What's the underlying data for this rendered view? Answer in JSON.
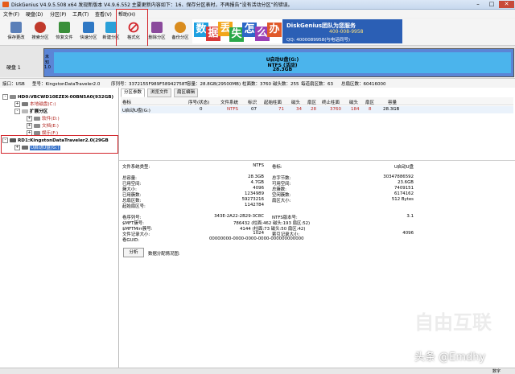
{
  "window": {
    "title": "DiskGenius V4.9.5.508 x64   发现新版本 V4.9.6.552 主要更新内容如下：16、保存分区表时，不再报告“没有活动分区”的错误。",
    "min": "–",
    "max": "□",
    "close": "✕"
  },
  "menu": [
    "文件(F)",
    "硬盘(D)",
    "分区(P)",
    "工具(T)",
    "查看(V)",
    "帮助(H)"
  ],
  "toolbar": [
    {
      "label": "保存更改",
      "icon": "save-icon",
      "color": "#5a7fb8"
    },
    {
      "label": "搜索分区",
      "icon": "search-icon",
      "color": "#c0392b"
    },
    {
      "label": "恢复文件",
      "icon": "recover-icon",
      "color": "#3a8f3a"
    },
    {
      "label": "快速分区",
      "icon": "quick-partition-icon",
      "color": "#2f78c4"
    },
    {
      "label": "新建分区",
      "icon": "new-partition-icon",
      "color": "#2aa0d8"
    },
    {
      "label": "格式化",
      "icon": "format-icon",
      "color": "#d2242a"
    },
    {
      "label": "删除分区",
      "icon": "delete-icon",
      "color": "#8b4a9c"
    },
    {
      "label": "备份分区",
      "icon": "backup-icon",
      "color": "#d98c1e"
    }
  ],
  "ad": {
    "chars": [
      "数",
      "据",
      "丢",
      "失",
      "怎",
      "么",
      "办"
    ],
    "brand": "DiskGenius团队为您服务",
    "phone": "400-008-9958",
    "qq": "QQ: 4000089958(与电话同号)"
  },
  "diskbar": {
    "disk_label": "硬盘 1",
    "side_labels": [
      "未",
      "知",
      "1.0"
    ],
    "name": "U启动U盘(G:)",
    "fs": "NTFS (活动)",
    "size": "28.3GB"
  },
  "infoline": {
    "iface": "接口：USB",
    "model": "型号：KingstonDataTraveler2.0",
    "serial": "序列号：3372155F989F58942758T",
    "capacity": "容量：28.8GB(29500MB)",
    "cylinders": "柱面数：3760",
    "heads": "磁头数：255",
    "sectors_per_track": "每道扇区数：63",
    "total_sectors": "总扇区数：60416000"
  },
  "tree": {
    "hd0": "HD0:VBCWD10EZEX-00BN5A0(932GB)",
    "hd0_children": [
      "本地磁盘(C:)",
      "扩展分区",
      "软件(D:)",
      "文档(E:)",
      "娱乐(F:)"
    ],
    "rd1": "RD1:KingstonDataTraveler2.0(29GB",
    "rd1_child": "U启动U盘(G:)"
  },
  "tabs": [
    "分区参数",
    "浏览文件",
    "扇区编辑"
  ],
  "partition_table": {
    "headers": [
      "卷标",
      "序号(状态)",
      "文件系统",
      "标识",
      "起始柱面",
      "磁头",
      "扇区",
      "终止柱面",
      "磁头",
      "扇区",
      "容量"
    ],
    "row": [
      "U启动U盘(G:)",
      "0",
      "NTFS",
      "07",
      "71",
      "34",
      "28",
      "3760",
      "184",
      "8",
      "28.3GB"
    ]
  },
  "details": {
    "fs_type_label": "文件系统类型:",
    "fs_type": "NTFS",
    "volume_label_label": "卷标:",
    "volume_label": "U启动U盘",
    "total_label": "总容量:",
    "total": "28.3GB",
    "total_bytes_label": "总字节数:",
    "total_bytes": "30347886592",
    "used_label": "已用空间:",
    "used": "4.7GB",
    "free_label": "可用空间:",
    "free": "23.6GB",
    "cluster_label": "簇大小:",
    "cluster": "4096",
    "total_clusters_label": "总簇数:",
    "total_clusters": "7409151",
    "used_clusters_label": "已用簇数:",
    "used_clusters": "1234989",
    "free_clusters_label": "空闲簇数:",
    "free_clusters": "6174162",
    "total_sectors_label": "总扇区数:",
    "total_sectors": "59273216",
    "sector_size_label": "扇区大小:",
    "sector_size": "512 Bytes",
    "start_sector_label": "起始扇区号:",
    "start_sector": "1142784",
    "serial_label": "卷序列号:",
    "serial": "343E-2A22-2B29-3C8C",
    "ntfs_ver_label": "NTFS版本号:",
    "ntfs_ver": "3.1",
    "mft_label": "$MFT簇号:",
    "mft": "786432 (柱面:462 磁头:193 扇区:52)",
    "mftmirr_label": "$MFTMirr簇号:",
    "mftmirr": "4144 (柱面:73 磁头:50 扇区:42)",
    "frs_label": "文件记录大小:",
    "frs": "1024",
    "irs_label": "索引记录大小:",
    "irs": "4096",
    "guid_label": "卷GUID:",
    "guid": "00000000-0000-0000-0000-000000000000",
    "analyze": "分析",
    "alloc_label": "数据分配情况图:"
  },
  "status": {
    "right": "数字"
  },
  "watermark": {
    "logo": "自由互联",
    "text": "头条 @Emdhy"
  }
}
